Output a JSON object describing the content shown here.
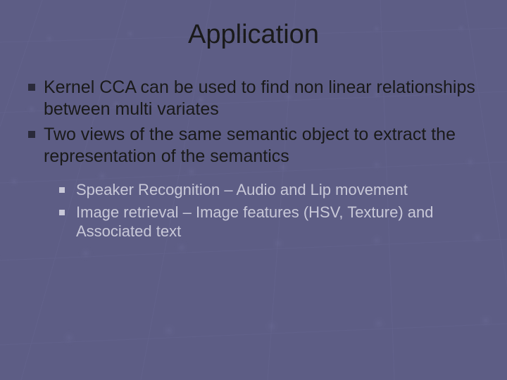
{
  "title": "Application",
  "mainBullets": [
    "Kernel CCA can be used to find non linear relationships between multi variates",
    "Two views of the same semantic object to extract the representation of the semantics"
  ],
  "subBullets": [
    "Speaker Recognition – Audio and Lip movement",
    "Image retrieval – Image features (HSV, Texture) and Associated text"
  ]
}
